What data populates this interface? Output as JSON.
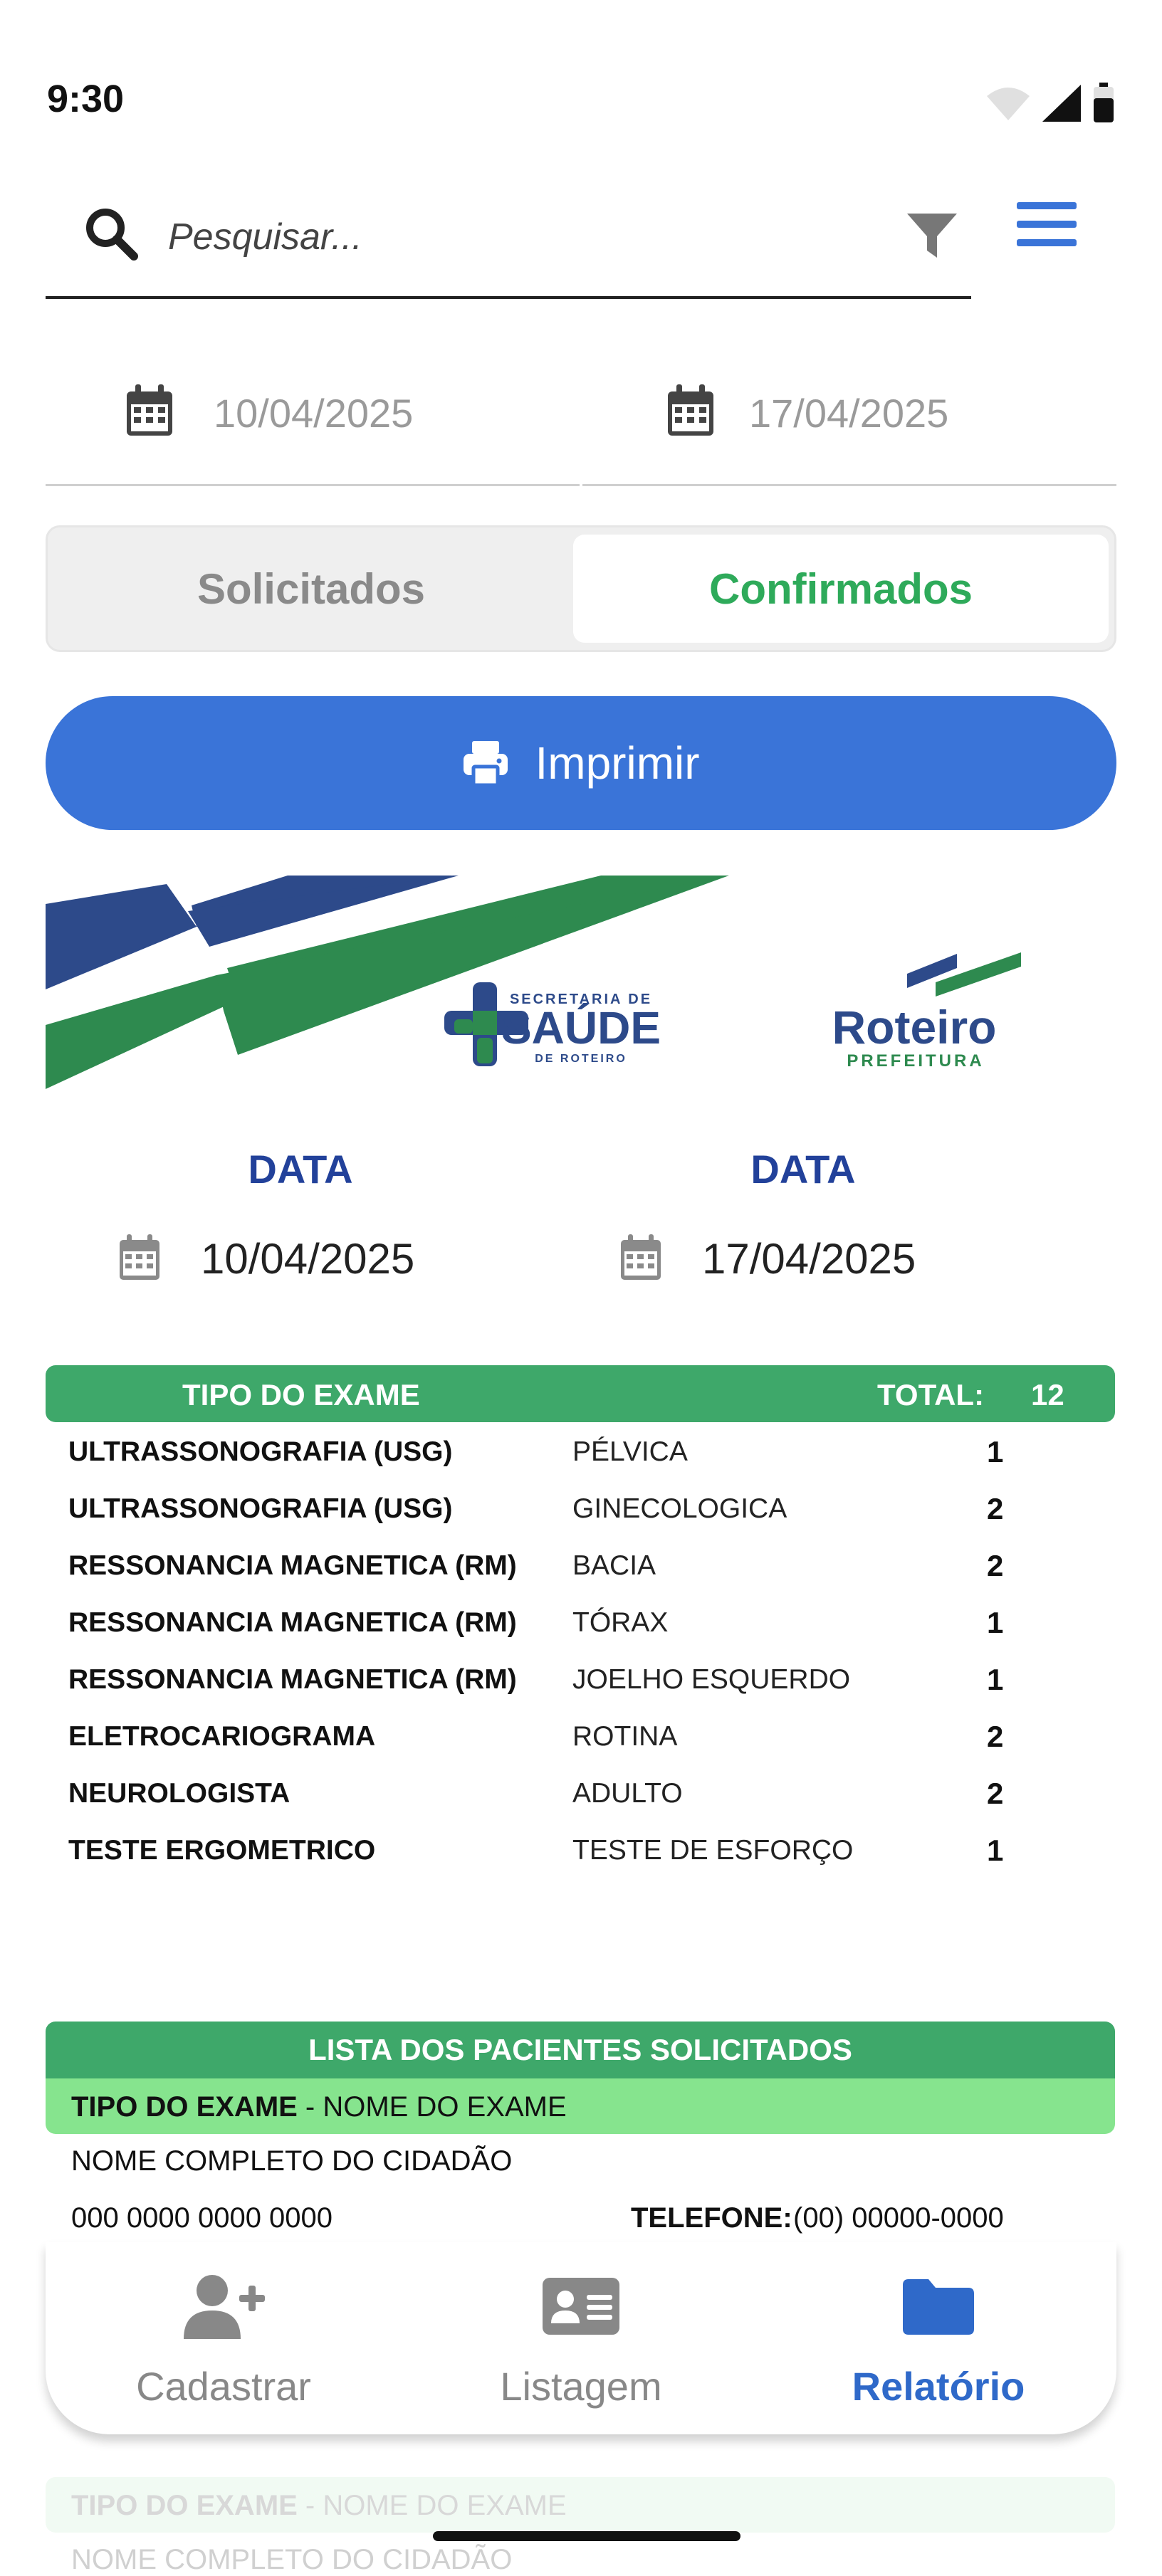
{
  "status_bar": {
    "time": "9:30"
  },
  "search": {
    "placeholder": "Pesquisar..."
  },
  "date_range": {
    "start": "10/04/2025",
    "end": "17/04/2025"
  },
  "segment": {
    "left": "Solicitados",
    "right": "Confirmados",
    "selected": "Confirmados"
  },
  "print_button": {
    "label": "Imprimir"
  },
  "banner": {
    "saude_small": "SECRETARIA DE",
    "saude_big": "SAÚDE",
    "saude_bottom": "DE ROTEIRO",
    "roteiro_big": "Roteiro",
    "roteiro_small": "PREFEITURA"
  },
  "report": {
    "data_label_left": "DATA",
    "data_label_right": "DATA",
    "date_left": "10/04/2025",
    "date_right": "17/04/2025"
  },
  "exam_table": {
    "header_type": "TIPO DO EXAME",
    "header_total_label": "TOTAL:",
    "header_total_value": "12",
    "rows": [
      {
        "type": "ULTRASSONOGRAFIA (USG)",
        "exam": "PÉLVICA",
        "count": "1"
      },
      {
        "type": "ULTRASSONOGRAFIA (USG)",
        "exam": "GINECOLOGICA",
        "count": "2"
      },
      {
        "type": "RESSONANCIA MAGNETICA (RM)",
        "exam": "BACIA",
        "count": "2"
      },
      {
        "type": "RESSONANCIA MAGNETICA (RM)",
        "exam": "TÓRAX",
        "count": "1"
      },
      {
        "type": "RESSONANCIA MAGNETICA (RM)",
        "exam": "JOELHO ESQUERDO",
        "count": "1"
      },
      {
        "type": "ELETROCARIOGRAMA",
        "exam": "ROTINA",
        "count": "2"
      },
      {
        "type": "NEUROLOGISTA",
        "exam": "ADULTO",
        "count": "2"
      },
      {
        "type": "TESTE ERGOMETRICO",
        "exam": "TESTE DE ESFORÇO",
        "count": "1"
      }
    ]
  },
  "patients": {
    "header": "LISTA DOS PACIENTES SOLICITADOS",
    "sub_bold": "TIPO DO EXAME",
    "sub_rest": " - NOME DO EXAME",
    "name": "NOME COMPLETO DO CIDADÃO",
    "doc": "000 0000 0000 0000",
    "phone_label": "TELEFONE:",
    "phone_value": "(00) 00000-0000"
  },
  "bottom_nav": {
    "items": [
      {
        "label": "Cadastrar",
        "icon": "add-user-icon"
      },
      {
        "label": "Listagem",
        "icon": "id-card-icon"
      },
      {
        "label": "Relatório",
        "icon": "folder-icon"
      }
    ],
    "active": "Relatório"
  },
  "colors": {
    "primary_blue": "#3a74d8",
    "green": "#3ea86a",
    "light_green": "#86e48e",
    "navy": "#22419a",
    "active_nav": "#2f69c9"
  }
}
